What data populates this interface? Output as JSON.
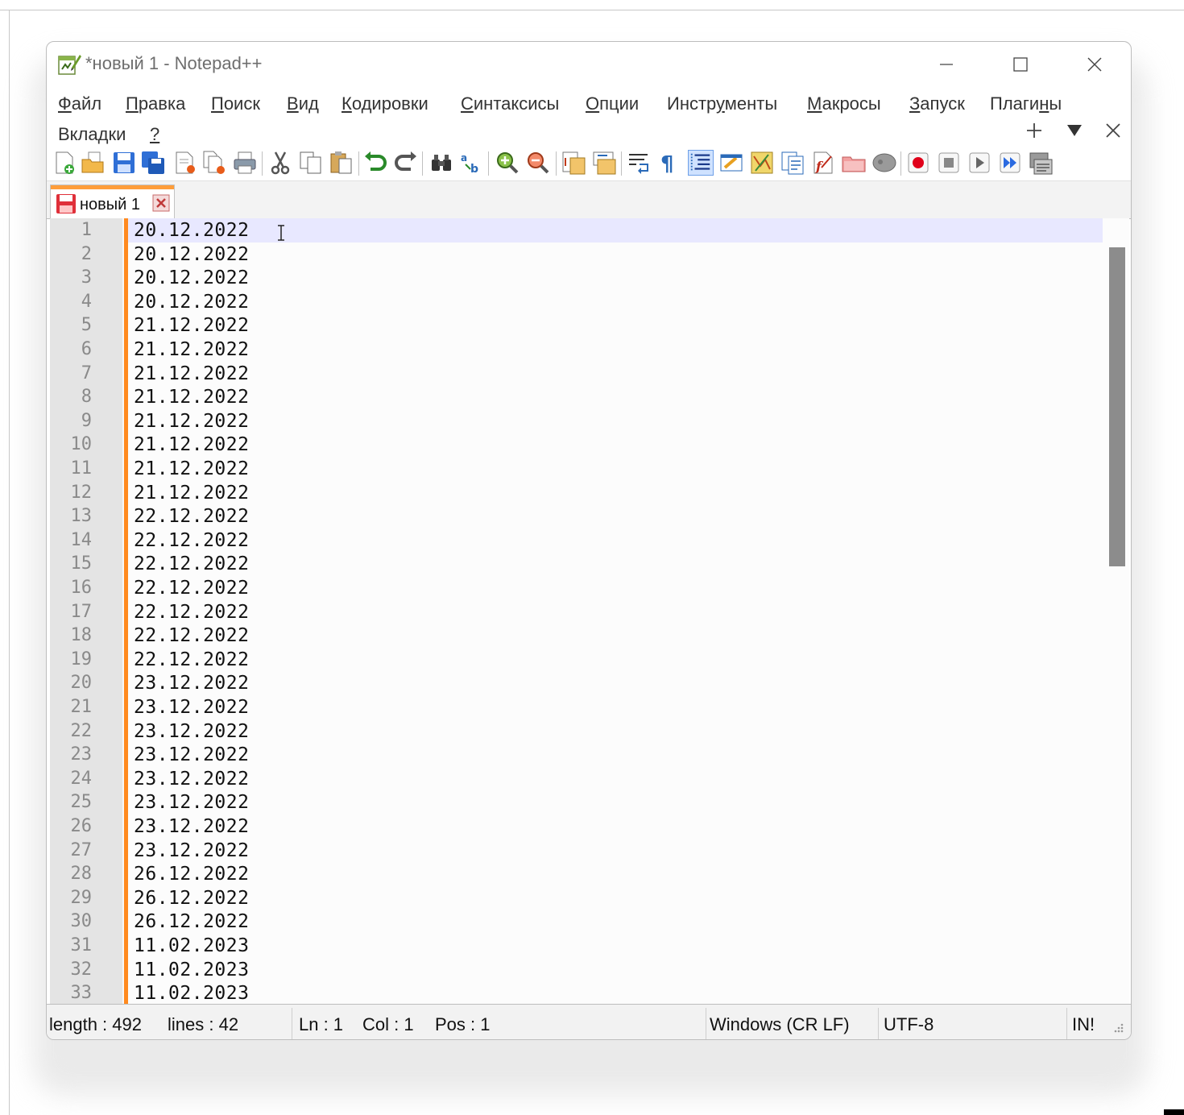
{
  "window": {
    "title": "*новый 1 - Notepad++",
    "app_icon": "notepadpp-icon"
  },
  "window_controls": [
    "minimize-icon",
    "maximize-icon",
    "close-icon"
  ],
  "menu": {
    "row1": [
      {
        "pre": "",
        "ul": "Ф",
        "post": "айл"
      },
      {
        "pre": "",
        "ul": "П",
        "post": "равка"
      },
      {
        "pre": "",
        "ul": "П",
        "post": "оиск"
      },
      {
        "pre": "",
        "ul": "В",
        "post": "ид"
      },
      {
        "pre": "",
        "ul": "К",
        "post": "одировки"
      },
      {
        "pre": "",
        "ul": "С",
        "post": "интаксисы"
      },
      {
        "pre": "",
        "ul": "О",
        "post": "пции"
      },
      {
        "pre": "Инстр",
        "ul": "у",
        "post": "менты"
      },
      {
        "pre": "",
        "ul": "М",
        "post": "акросы"
      },
      {
        "pre": "",
        "ul": "З",
        "post": "апуск"
      },
      {
        "pre": "Плаги",
        "ul": "н",
        "post": "ы"
      }
    ],
    "row2": [
      {
        "pre": "Вкладки",
        "ul": "",
        "post": ""
      },
      {
        "pre": "",
        "ul": "?",
        "post": ""
      }
    ],
    "right_icons": [
      "add-icon",
      "dropdown-arrow-icon",
      "close-icon"
    ]
  },
  "toolbar": {
    "buttons": [
      "new-file-icon",
      "open-file-icon",
      "save-icon",
      "save-all-icon",
      "close-file-icon",
      "close-all-icon",
      "print-icon",
      "cut-icon",
      "copy-icon",
      "paste-icon",
      "undo-icon",
      "redo-icon",
      "find-icon",
      "replace-icon",
      "zoom-in-icon",
      "zoom-out-icon",
      "sync-vertical-icon",
      "sync-horizontal-icon",
      "word-wrap-icon",
      "show-all-chars-icon",
      "indent-guide-icon",
      "user-defined-language-icon",
      "document-map-icon",
      "function-list-icon",
      "document-list-icon",
      "folder-as-workspace-icon",
      "monitoring-icon",
      "record-macro-icon",
      "stop-recording-icon",
      "play-macro-icon",
      "run-macro-multiple-icon",
      "save-macro-icon"
    ]
  },
  "tabs": [
    {
      "label": "новый 1",
      "icon": "unsaved-file-icon",
      "close_icon": "tab-close-icon"
    }
  ],
  "editor": {
    "lines": [
      {
        "n": "1",
        "t": "20.12.2022"
      },
      {
        "n": "2",
        "t": "20.12.2022"
      },
      {
        "n": "3",
        "t": "20.12.2022"
      },
      {
        "n": "4",
        "t": "20.12.2022"
      },
      {
        "n": "5",
        "t": "21.12.2022"
      },
      {
        "n": "6",
        "t": "21.12.2022"
      },
      {
        "n": "7",
        "t": "21.12.2022"
      },
      {
        "n": "8",
        "t": "21.12.2022"
      },
      {
        "n": "9",
        "t": "21.12.2022"
      },
      {
        "n": "10",
        "t": "21.12.2022"
      },
      {
        "n": "11",
        "t": "21.12.2022"
      },
      {
        "n": "12",
        "t": "21.12.2022"
      },
      {
        "n": "13",
        "t": "22.12.2022"
      },
      {
        "n": "14",
        "t": "22.12.2022"
      },
      {
        "n": "15",
        "t": "22.12.2022"
      },
      {
        "n": "16",
        "t": "22.12.2022"
      },
      {
        "n": "17",
        "t": "22.12.2022"
      },
      {
        "n": "18",
        "t": "22.12.2022"
      },
      {
        "n": "19",
        "t": "22.12.2022"
      },
      {
        "n": "20",
        "t": "23.12.2022"
      },
      {
        "n": "21",
        "t": "23.12.2022"
      },
      {
        "n": "22",
        "t": "23.12.2022"
      },
      {
        "n": "23",
        "t": "23.12.2022"
      },
      {
        "n": "24",
        "t": "23.12.2022"
      },
      {
        "n": "25",
        "t": "23.12.2022"
      },
      {
        "n": "26",
        "t": "23.12.2022"
      },
      {
        "n": "27",
        "t": "23.12.2022"
      },
      {
        "n": "28",
        "t": "26.12.2022"
      },
      {
        "n": "29",
        "t": "26.12.2022"
      },
      {
        "n": "30",
        "t": "26.12.2022"
      },
      {
        "n": "31",
        "t": "11.02.2023"
      },
      {
        "n": "32",
        "t": "11.02.2023"
      },
      {
        "n": "33",
        "t": "11.02.2023"
      }
    ],
    "current_line_color": "#e8e8ff",
    "change_marker_color": "#ff8a1f"
  },
  "statusbar": {
    "length": "length : 492",
    "lines": "lines : 42",
    "ln": "Ln : 1",
    "col": "Col : 1",
    "pos": "Pos : 1",
    "eol": "Windows (CR LF)",
    "encoding": "UTF-8",
    "mode": "IN!"
  }
}
